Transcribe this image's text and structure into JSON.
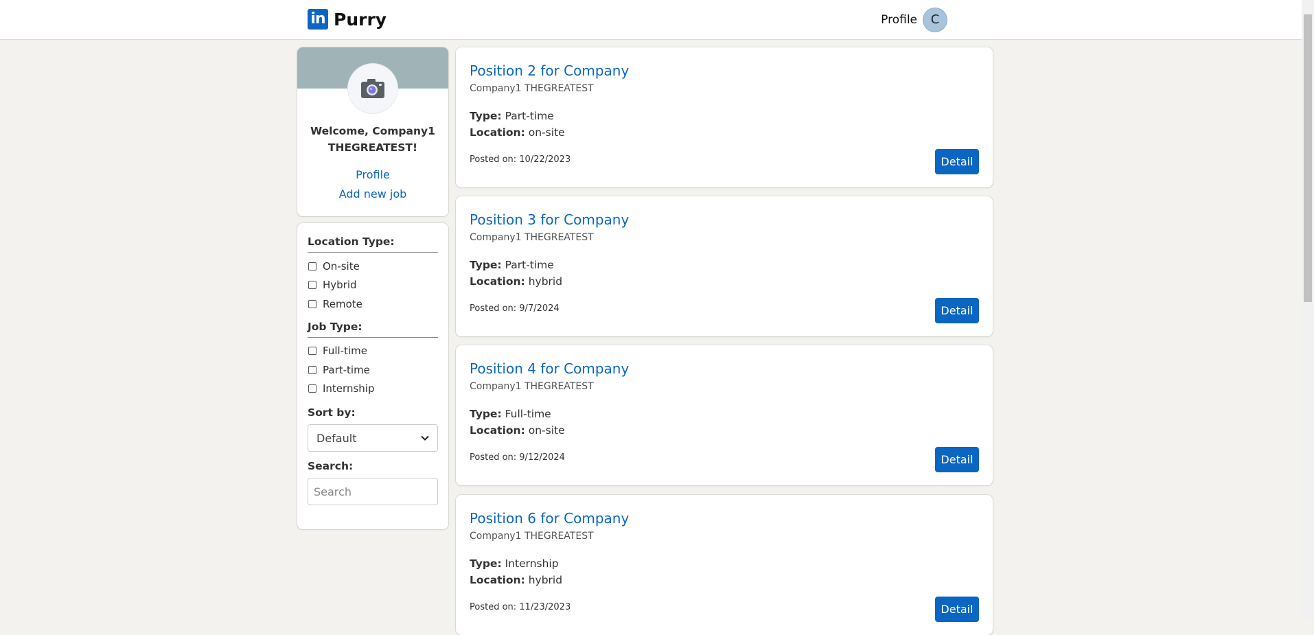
{
  "header": {
    "logo_text": "in",
    "brand": "Purry",
    "profile_label": "Profile",
    "avatar_initial": "C"
  },
  "sidebar": {
    "welcome_line1": "Welcome, Company1",
    "welcome_line2": "THEGREATEST!",
    "profile_link": "Profile",
    "add_job_link": "Add new job"
  },
  "filters": {
    "location_type_title": "Location Type:",
    "location_options": [
      "On-site",
      "Hybrid",
      "Remote"
    ],
    "job_type_title": "Job Type:",
    "job_type_options": [
      "Full-time",
      "Part-time",
      "Internship"
    ],
    "sort_label": "Sort by:",
    "sort_value": "Default",
    "search_label": "Search:",
    "search_placeholder": "Search"
  },
  "jobs": [
    {
      "title": "Position 2 for Company",
      "company": "Company1 THEGREATEST",
      "type_label": "Type:",
      "type": "Part-time",
      "location_label": "Location:",
      "location": "on-site",
      "posted": "Posted on: 10/22/2023",
      "button": "Detail"
    },
    {
      "title": "Position 3 for Company",
      "company": "Company1 THEGREATEST",
      "type_label": "Type:",
      "type": "Part-time",
      "location_label": "Location:",
      "location": "hybrid",
      "posted": "Posted on: 9/7/2024",
      "button": "Detail"
    },
    {
      "title": "Position 4 for Company",
      "company": "Company1 THEGREATEST",
      "type_label": "Type:",
      "type": "Full-time",
      "location_label": "Location:",
      "location": "on-site",
      "posted": "Posted on: 9/12/2024",
      "button": "Detail"
    },
    {
      "title": "Position 6 for Company",
      "company": "Company1 THEGREATEST",
      "type_label": "Type:",
      "type": "Internship",
      "location_label": "Location:",
      "location": "hybrid",
      "posted": "Posted on: 11/23/2023",
      "button": "Detail"
    }
  ],
  "colors": {
    "accent": "#0a66c2",
    "background": "#f3f2ef",
    "banner": "#a0b4b7"
  }
}
